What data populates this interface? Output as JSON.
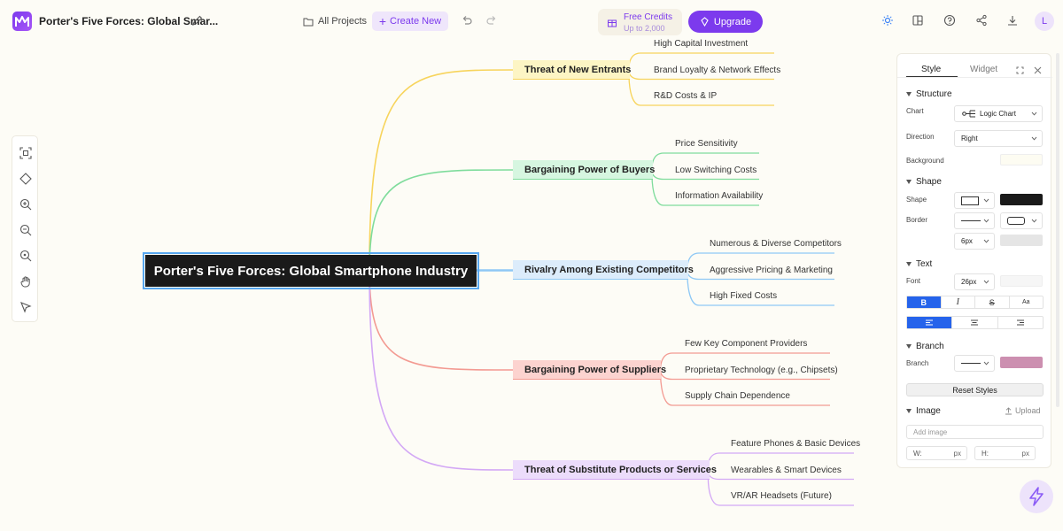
{
  "header": {
    "doc_title": "Porter's Five Forces: Global Smar...",
    "all_projects": "All Projects",
    "create_new": "Create New",
    "credits_title": "Free Credits",
    "credits_sub": "Up to 2,000",
    "upgrade": "Upgrade",
    "avatar": "L"
  },
  "mindmap": {
    "root": "Porter's Five Forces: Global Smartphone Industry",
    "branches": [
      {
        "label": "Threat of New Entrants",
        "color": "#f7d45c",
        "fill": "#fdf5c4",
        "leaves": [
          "High Capital Investment",
          "Brand Loyalty & Network Effects",
          "R&D Costs & IP"
        ]
      },
      {
        "label": "Bargaining Power of Buyers",
        "color": "#7fdc9c",
        "fill": "#d6f6e0",
        "leaves": [
          "Price Sensitivity",
          "Low Switching Costs",
          "Information Availability"
        ]
      },
      {
        "label": "Rivalry Among Existing Competitors",
        "color": "#8ec8f5",
        "fill": "#dcecfb",
        "leaves": [
          "Numerous & Diverse Competitors",
          "Aggressive Pricing & Marketing",
          "High Fixed Costs"
        ]
      },
      {
        "label": "Bargaining Power of Suppliers",
        "color": "#f39a92",
        "fill": "#fcd3cf",
        "leaves": [
          "Few Key Component Providers",
          "Proprietary Technology (e.g., Chipsets)",
          "Supply Chain Dependence"
        ]
      },
      {
        "label": "Threat of Substitute Products or Services",
        "color": "#d3a8f5",
        "fill": "#ecdcfb",
        "leaves": [
          "Feature Phones & Basic Devices",
          "Wearables & Smart Devices",
          "VR/AR Headsets (Future)"
        ]
      }
    ]
  },
  "panel": {
    "tab_style": "Style",
    "tab_widget": "Widget",
    "structure": "Structure",
    "chart_label": "Chart",
    "chart_value": "Logic Chart",
    "direction_label": "Direction",
    "direction_value": "Right",
    "background_label": "Background",
    "shape_section": "Shape",
    "shape_label": "Shape",
    "border_label": "Border",
    "border_width": "6px",
    "text_section": "Text",
    "font_label": "Font",
    "font_size": "26px",
    "branch_section": "Branch",
    "branch_label": "Branch",
    "reset": "Reset Styles",
    "image_section": "Image",
    "upload": "Upload",
    "add_image_placeholder": "Add image",
    "w_label": "W:",
    "h_label": "H:",
    "unit": "px",
    "shape_fill_color": "#1a1a1a",
    "branch_color": "#cc8fb0"
  }
}
